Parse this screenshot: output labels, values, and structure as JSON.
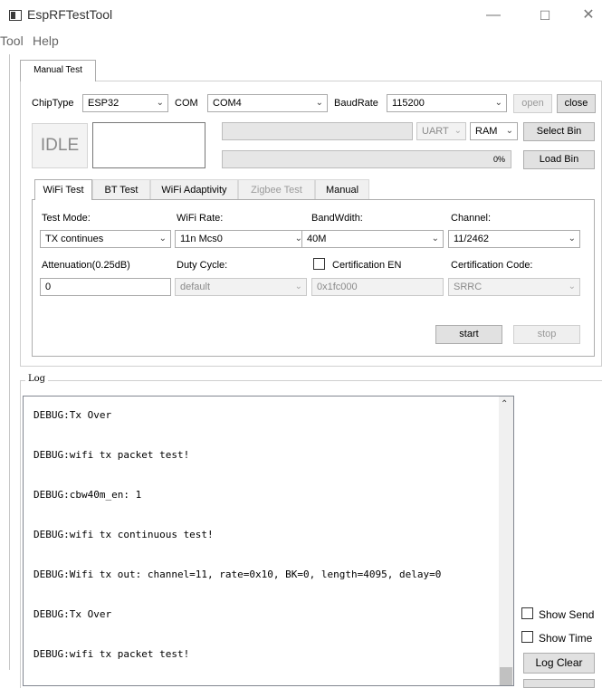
{
  "window": {
    "title": "EspRFTestTool",
    "minimize": "—",
    "maximize": "☐",
    "close": "✕"
  },
  "menu": [
    "Tool",
    "Help"
  ],
  "main_tab": "Manual Test",
  "connection": {
    "chiptype_label": "ChipType",
    "chiptype_value": "ESP32",
    "com_label": "COM",
    "com_value": "COM4",
    "baud_label": "BaudRate",
    "baud_value": "115200",
    "open": "open",
    "close": "close"
  },
  "status": "IDLE",
  "bin": {
    "mode": "UART",
    "mem": "RAM",
    "select": "Select Bin",
    "load": "Load Bin",
    "progress_text": "0%",
    "progress": 0
  },
  "subtabs": [
    "WiFi Test",
    "BT Test",
    "WiFi Adaptivity",
    "Zigbee Test",
    "Manual"
  ],
  "wifi": {
    "test_mode_label": "Test Mode:",
    "test_mode": "TX continues",
    "rate_label": "WiFi Rate:",
    "rate": "11n Mcs0",
    "bw_label": "BandWdith:",
    "bw": "40M",
    "channel_label": "Channel:",
    "channel": "11/2462",
    "atten_label": "Attenuation(0.25dB)",
    "atten": "0",
    "duty_label": "Duty Cycle:",
    "duty": "default",
    "cert_en_label": "Certification EN",
    "cert_addr": "0x1fc000",
    "cert_code_label": "Certification Code:",
    "cert_code": "SRRC",
    "start": "start",
    "stop": "stop"
  },
  "log": {
    "label": "Log",
    "lines": [
      "DEBUG:Tx Over",
      "DEBUG:wifi tx packet test!",
      "DEBUG:cbw40m_en: 1",
      "DEBUG:wifi tx continuous test!",
      "DEBUG:Wifi tx out: channel=11, rate=0x10, BK=0, length=4095, delay=0",
      "DEBUG:Tx Over",
      "DEBUG:wifi tx packet test!"
    ],
    "show_send": "Show Send",
    "show_time": "Show Time",
    "clear": "Log Clear"
  }
}
